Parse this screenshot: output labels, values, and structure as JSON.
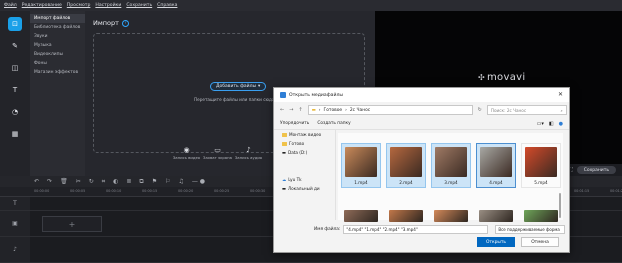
{
  "menubar": [
    "Файл",
    "Редактирование",
    "Просмотр",
    "Настройки",
    "Сохранить",
    "Справка"
  ],
  "toolstrip_icons": [
    "import-icon",
    "magic-wand-icon",
    "filters-icon",
    "transitions-icon",
    "titles-icon",
    "stickers-icon",
    "more-icon"
  ],
  "sidemenu": {
    "items": [
      "Импорт файлов",
      "Библиотека файлов",
      "Звуки",
      "Музыка",
      "Видеоклипы",
      "Фоны",
      "Магазин эффектов"
    ],
    "selected": 0
  },
  "import": {
    "title": "Импорт",
    "add_files": "Добавить файлы",
    "drop_hint": "Перетащите файлы или папки сюда"
  },
  "capture": [
    {
      "label": "Запись видео",
      "icon": "webcam-icon"
    },
    {
      "label": "Захват экрана",
      "icon": "screen-capture-icon"
    },
    {
      "label": "Запись аудио",
      "icon": "microphone-icon"
    },
    {
      "label": "М",
      "icon": "more-icon"
    }
  ],
  "preview": {
    "logo": "movavi",
    "save_label": "Сохранить"
  },
  "ruler_ticks": [
    "00:00:00",
    "00:00:05",
    "00:00:10",
    "00:00:15",
    "00:00:20",
    "00:00:25",
    "00:00:30",
    "00:00:35",
    "00:00:40",
    "00:00:45",
    "00:00:50",
    "00:00:55",
    "00:01:00",
    "00:01:05",
    "00:01:10",
    "00:01:15",
    "00:01:20"
  ],
  "dialog": {
    "title": "Открыть медиафайлы",
    "path": [
      "Готовое",
      "2с Чанос"
    ],
    "search_placeholder": "Поиск: 2с Чанос",
    "organize": "Упорядочить",
    "new_folder": "Создать папку",
    "nav": [
      "Монтаж видео",
      "Готово",
      "Data (D:)",
      "Lyu Tk",
      "Локальный ди"
    ],
    "files": [
      {
        "name": "1.mp4",
        "color": "#c98a5a"
      },
      {
        "name": "2.mp4",
        "color": "#b5683f"
      },
      {
        "name": "3.mp4",
        "color": "#9f7a65"
      },
      {
        "name": "4.mp4",
        "color": "#a8a8a4"
      },
      {
        "name": "5.mp4",
        "color": "#d44a2a"
      }
    ],
    "files_row2": [
      "#8f6b58",
      "#c2784a",
      "#d48a5a",
      "#9a8f84",
      "#6fa65a"
    ],
    "filename_label": "Имя файла:",
    "filename_value": "\"4.mp4\" \"1.mp4\" \"2.mp4\" \"3.mp4\"",
    "filter": "Все поддерживаемые форма",
    "open": "Открыть",
    "cancel": "Отмена"
  }
}
